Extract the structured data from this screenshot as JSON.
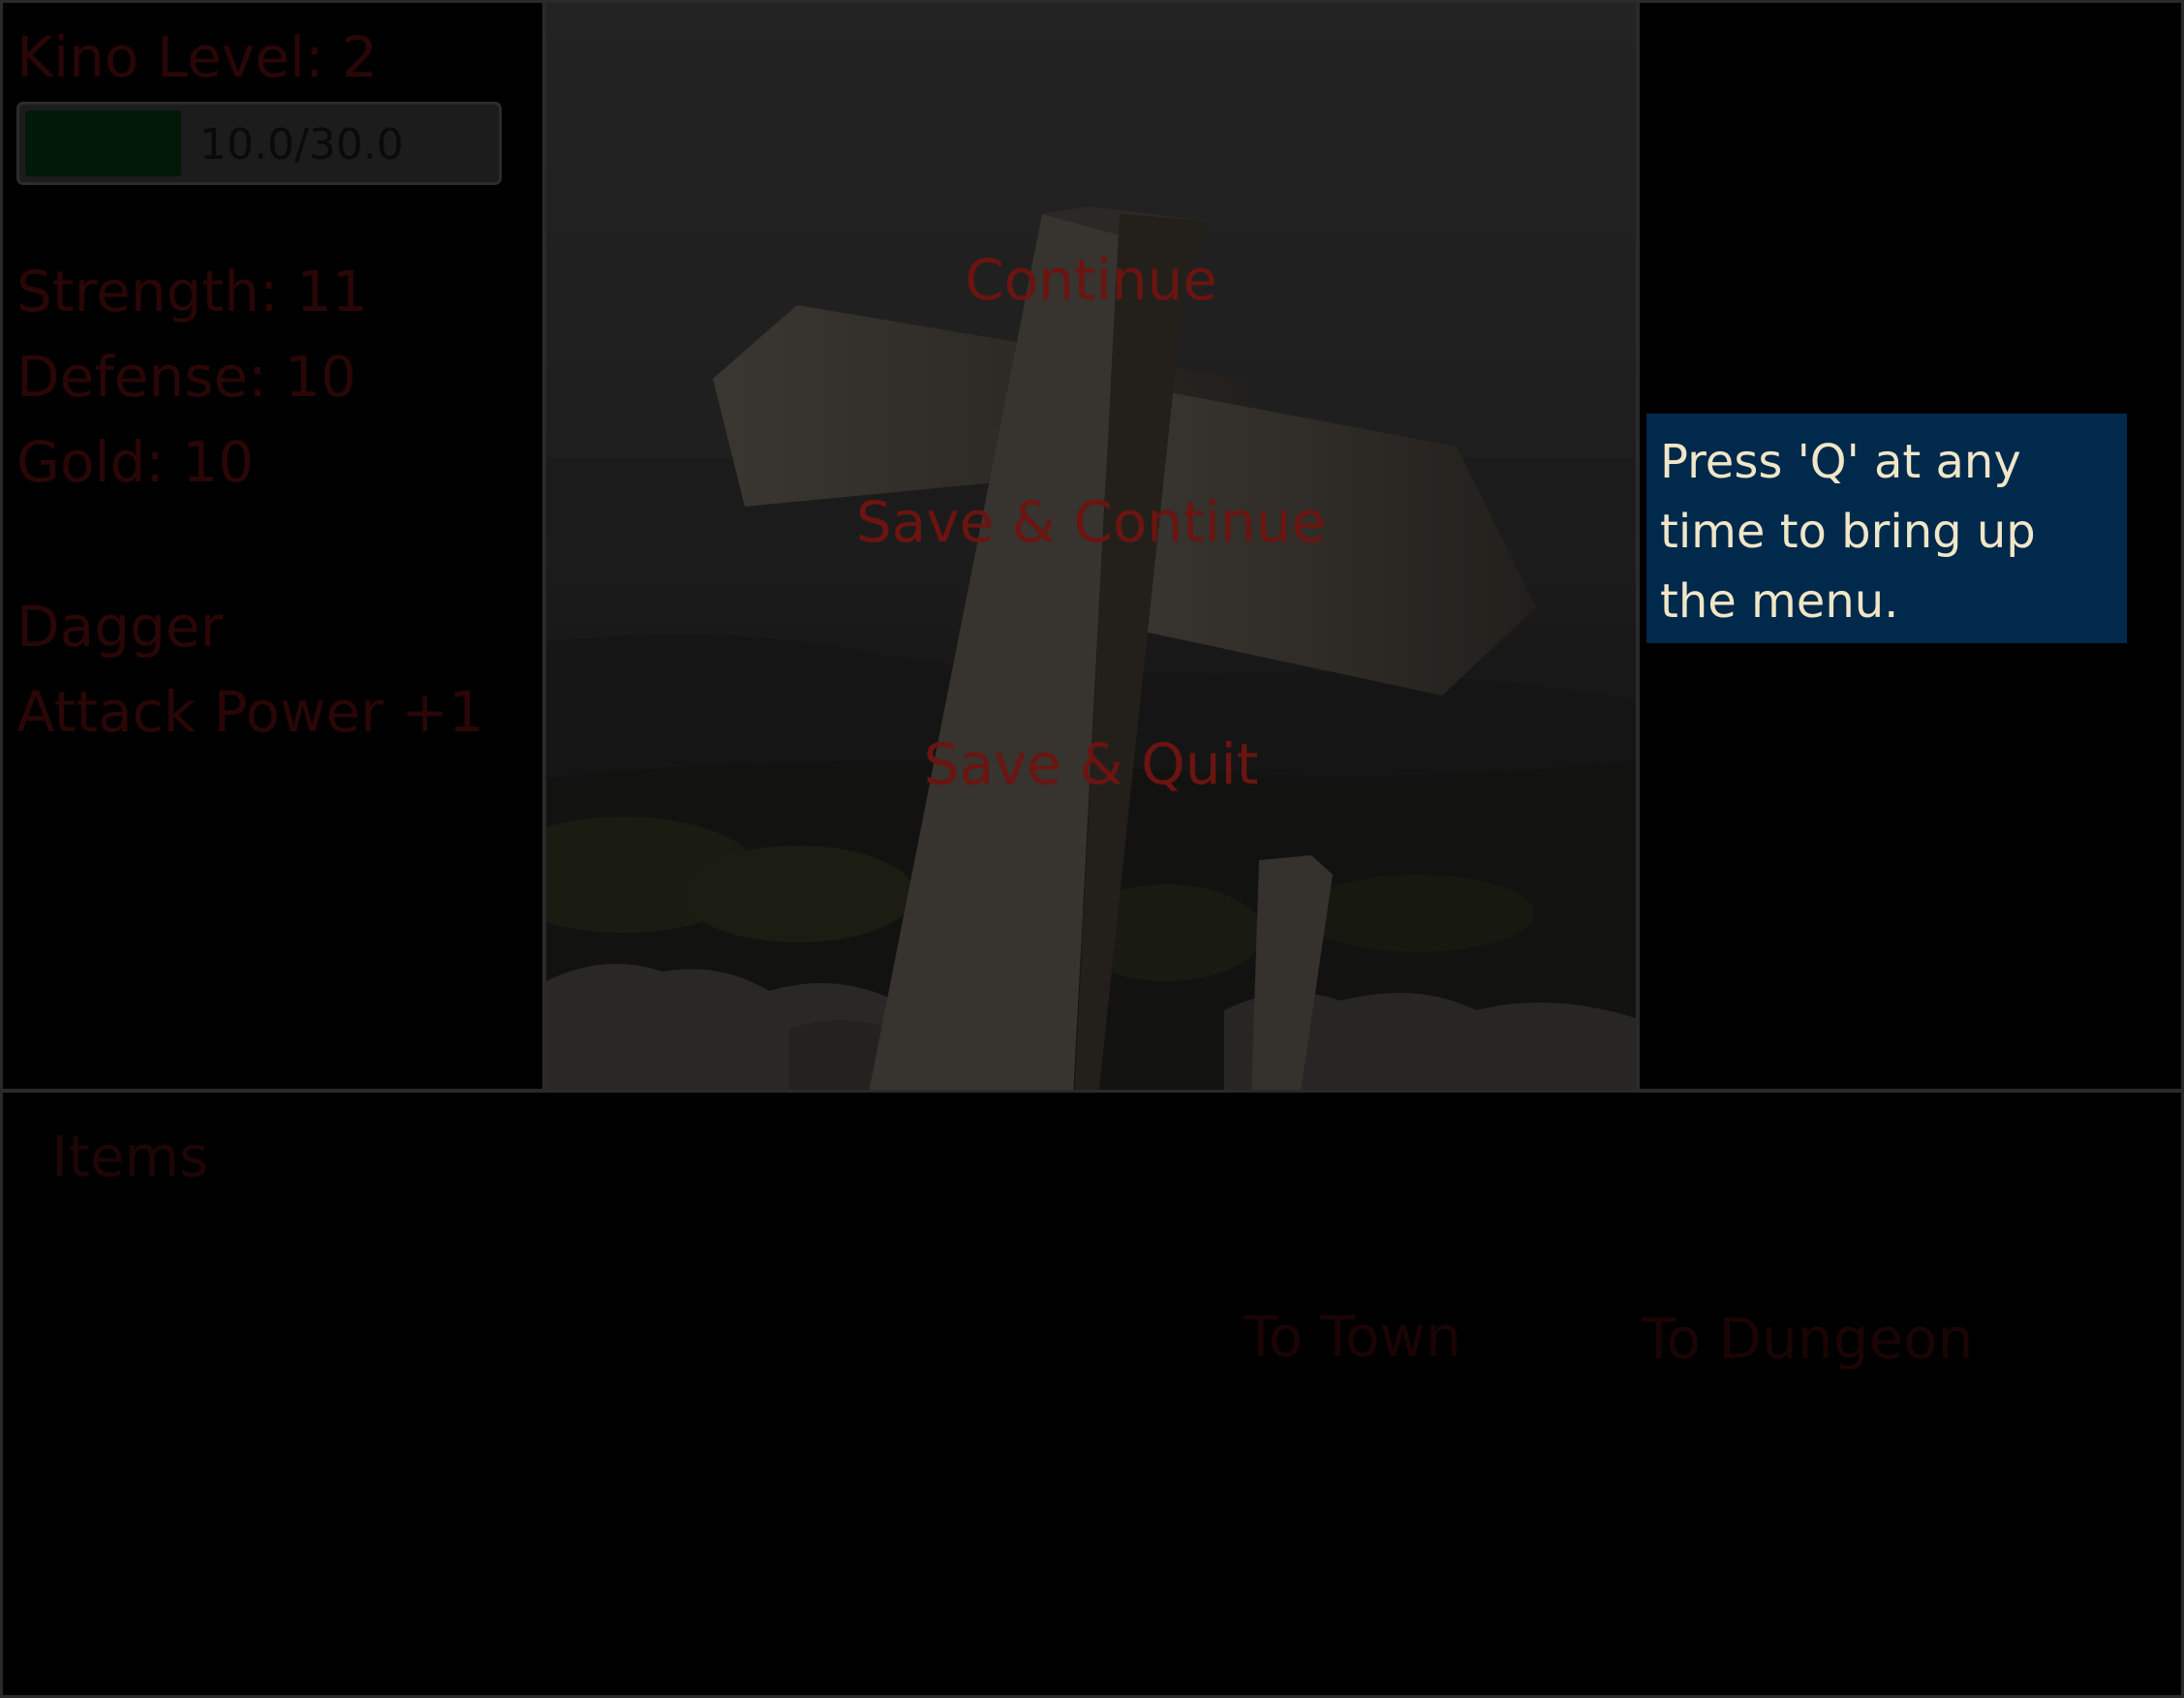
{
  "player": {
    "level_label": "Kino Level: 2",
    "xp_text": "10.0/30.0",
    "xp_fraction": 0.3333,
    "strength": "Strength: 11",
    "defense": "Defense: 10",
    "gold": "Gold: 10"
  },
  "equipment": {
    "weapon_name": "Dagger",
    "weapon_bonus": "Attack Power +1"
  },
  "menu": {
    "continue": "Continue",
    "save_continue": "Save & Continue",
    "save_quit": "Save & Quit"
  },
  "tooltip": {
    "text": "Press 'Q' at any time to bring up the menu."
  },
  "bottom": {
    "items_label": "Items",
    "to_town": "To Town",
    "to_dungeon": "To Dungeon"
  },
  "colors": {
    "menu_text": "#6b1410",
    "dimmed_text": "#2a0606",
    "tooltip_bg": "#00294b",
    "tooltip_text": "#f0e6c8"
  }
}
